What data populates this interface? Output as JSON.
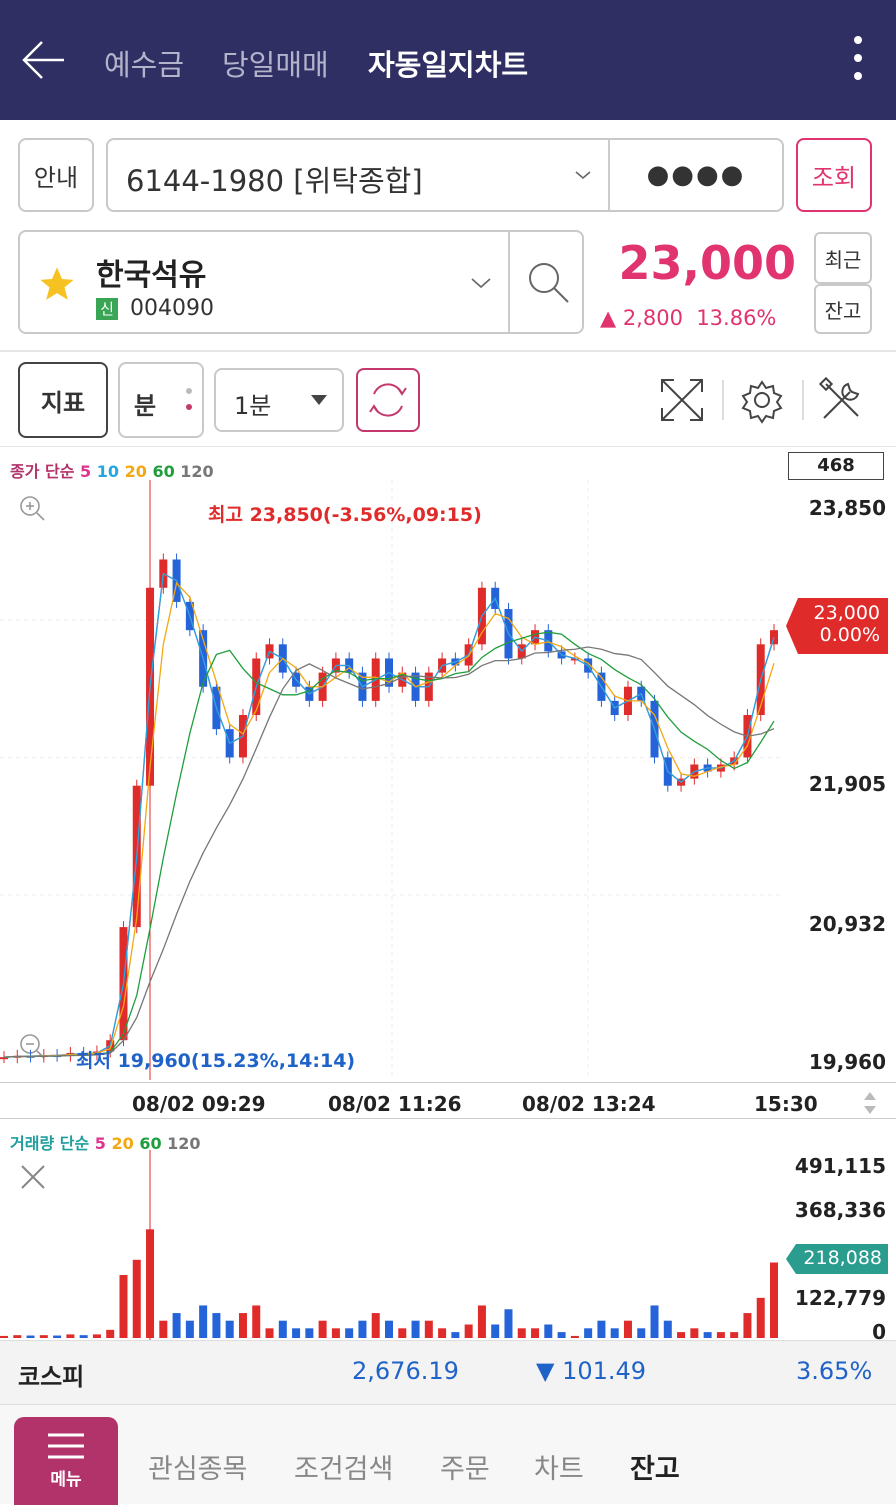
{
  "header": {
    "tabs": [
      {
        "label": "예수금"
      },
      {
        "label": "당일매매"
      },
      {
        "label": "자동일지차트"
      }
    ]
  },
  "account": {
    "guide_label": "안내",
    "number": "6144-1980 [위탁종합]",
    "password_mask": "●●●●",
    "inquiry_label": "조회"
  },
  "stock": {
    "name": "한국석유",
    "badge": "신",
    "code": "004090",
    "price": "23,000",
    "change": "▲ 2,800",
    "change_rate": "13.86%",
    "recent_label": "최근",
    "balance_label": "잔고"
  },
  "toolbar": {
    "indicator_label": "지표",
    "period_type": "분",
    "period_value": "1분"
  },
  "price_chart": {
    "legend_prefix": "종가 단순",
    "legend_periods": [
      "5",
      "10",
      "20",
      "60",
      "120"
    ],
    "legend_colors": [
      "#e0338f",
      "#22a7e0",
      "#f3a812",
      "#1f9e3d",
      "#777777"
    ],
    "count_box": "468",
    "y_ticks": [
      "23,850",
      "21,905",
      "20,932",
      "19,960"
    ],
    "current_tag_price": "23,000",
    "current_tag_rate": "0.00%",
    "max_label": "최고 23,850(-3.56%,09:15)",
    "min_label": "최저 19,960(15.23%,14:14)",
    "x_ticks": [
      "08/02 09:29",
      "08/02 11:26",
      "08/02 13:24",
      "15:30"
    ]
  },
  "volume_chart": {
    "legend_prefix": "거래량 단순",
    "legend_periods": [
      "5",
      "20",
      "60",
      "120"
    ],
    "legend_colors": [
      "#e0338f",
      "#f3a812",
      "#1f9e3d",
      "#777777"
    ],
    "y_ticks": [
      "491,115",
      "368,336",
      "122,779",
      "0"
    ],
    "current_tag": "218,088"
  },
  "chart_data": {
    "type": "candlestick",
    "title": "",
    "x_ticks": [
      "08/02 09:29",
      "08/02 11:26",
      "08/02 13:24",
      "15:30"
    ],
    "ylim": [
      19960,
      23850
    ],
    "close": [
      19980,
      19990,
      19985,
      19995,
      19990,
      20010,
      20000,
      20020,
      20100,
      20900,
      21900,
      23300,
      23500,
      23200,
      23000,
      22600,
      22300,
      22100,
      22400,
      22800,
      22900,
      22700,
      22600,
      22500,
      22700,
      22800,
      22700,
      22500,
      22800,
      22600,
      22700,
      22500,
      22700,
      22800,
      22750,
      22900,
      23300,
      23150,
      22800,
      22900,
      23000,
      22850,
      22800,
      22800,
      22700,
      22500,
      22400,
      22600,
      22500,
      22100,
      21900,
      21950,
      22050,
      22000,
      22050,
      22100,
      22400,
      22900,
      23000
    ],
    "volume_ylim": [
      0,
      491115
    ],
    "last_volume": 218088
  },
  "market": {
    "name": "코스피",
    "value": "2,676.19",
    "change": "▼ 101.49",
    "rate": "3.65%"
  },
  "bottom_nav": {
    "menu_label": "메뉴",
    "items": [
      {
        "label": "관심종목"
      },
      {
        "label": "조건검색"
      },
      {
        "label": "주문"
      },
      {
        "label": "차트"
      },
      {
        "label": "잔고"
      }
    ]
  }
}
